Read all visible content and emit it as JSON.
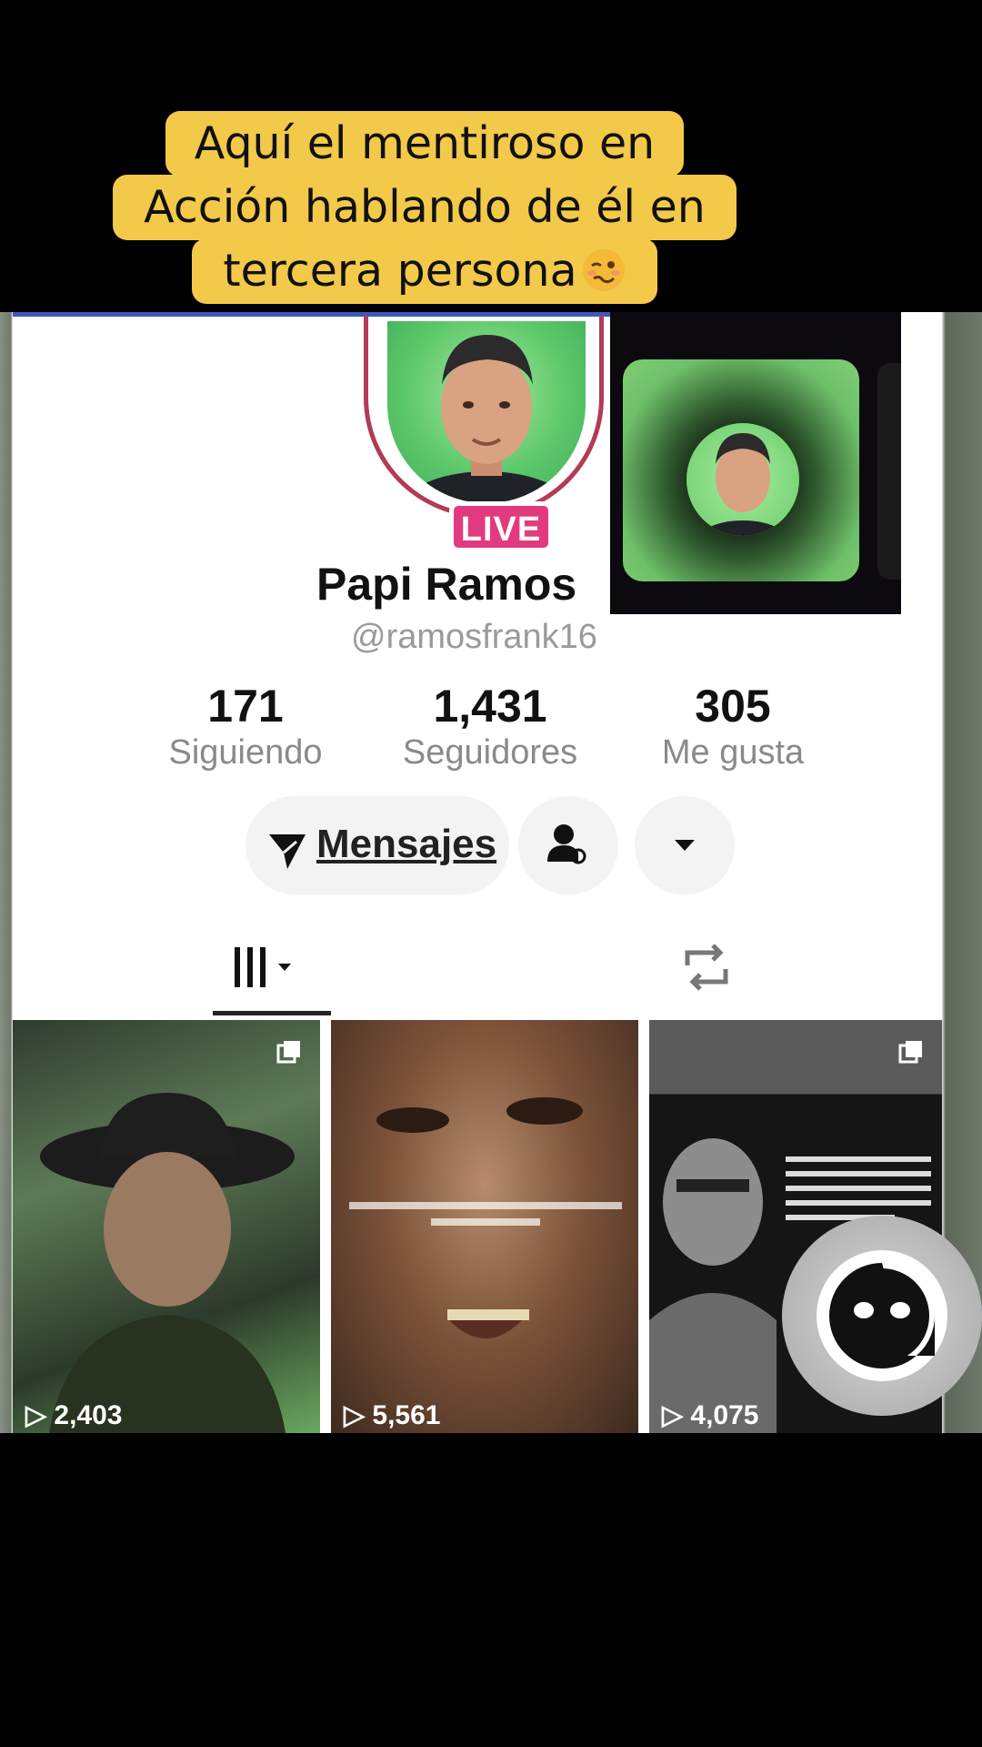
{
  "caption": {
    "line1": "Aquí el mentiroso en",
    "line2": "Acción hablando de él en",
    "line3": "tercera persona",
    "emoji": "woozy-face-emoji"
  },
  "profile": {
    "live_badge": "LIVE",
    "display_name": "Papi Ramos",
    "handle": "@ramosfrank16"
  },
  "stats": [
    {
      "value": "171",
      "label": "Siguiendo"
    },
    {
      "value": "1,431",
      "label": "Seguidores"
    },
    {
      "value": "305",
      "label": "Me gusta"
    }
  ],
  "actions": {
    "messages_label": "Mensajes",
    "friend_icon": "person-icon",
    "more_icon": "caret-down-icon"
  },
  "tabs": {
    "videos_icon": "videos-grid-icon",
    "reposts_icon": "repost-icon"
  },
  "videos": [
    {
      "views": "2,403"
    },
    {
      "views": "5,561"
    },
    {
      "views": "4,075"
    }
  ],
  "colors": {
    "caption_bg": "#f3c94a",
    "live_badge": "#e33a7f",
    "avatar_ring": "#b23b55",
    "pip_green": "#6fc06a"
  }
}
